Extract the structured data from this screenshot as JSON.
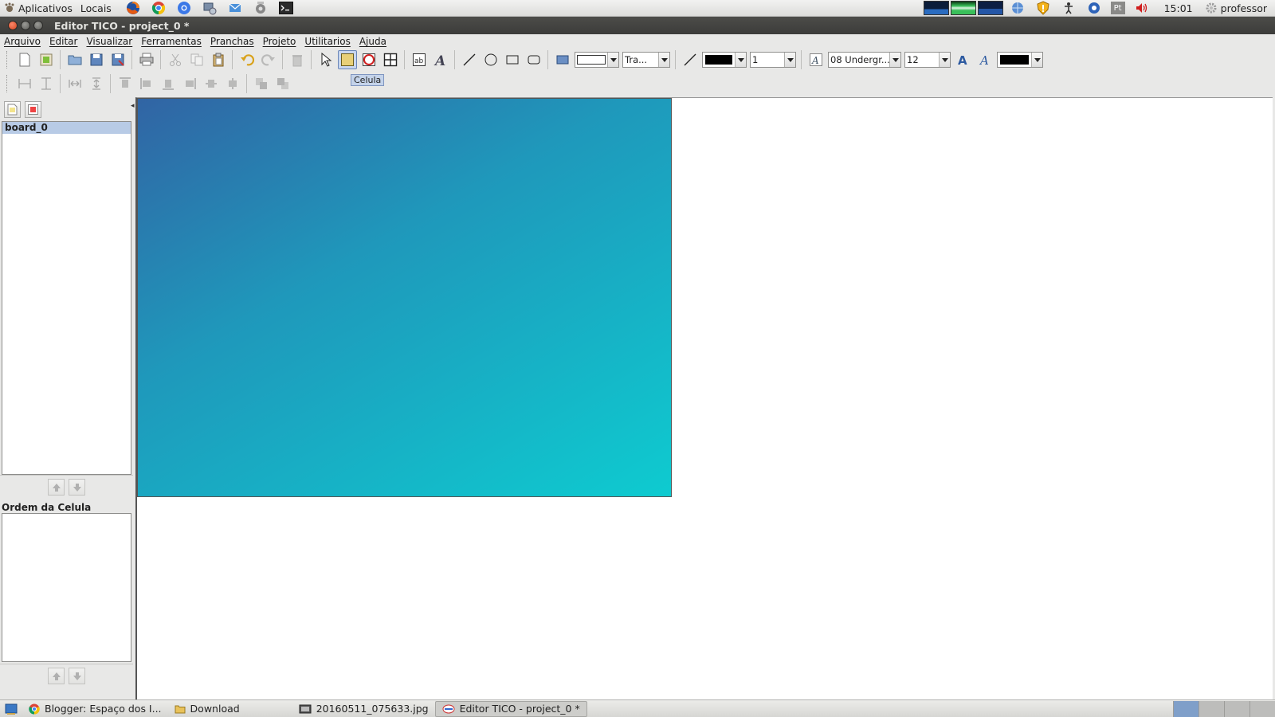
{
  "system_panel": {
    "menus": [
      "Aplicativos",
      "Locais"
    ],
    "launchers": [
      "firefox-icon",
      "chrome-icon",
      "chromium-icon",
      "network-settings-icon",
      "mail-icon",
      "update-icon",
      "terminal-icon"
    ],
    "tray_keyboard_label": "Pt",
    "clock": "15:01",
    "user": "professor"
  },
  "window": {
    "title": "Editor TICO - project_0 *"
  },
  "menubar": {
    "items": [
      "Arquivo",
      "Editar",
      "Visualizar",
      "Ferramentas",
      "Pranchas",
      "Projeto",
      "Utilitarios",
      "Ajuda"
    ]
  },
  "toolbar": {
    "tooltip": "Celula",
    "fill_mode": "Tra...",
    "line_width": "1",
    "font_name": "08 Undergr...",
    "font_size": "12",
    "line_color": "#000000",
    "text_color": "#000000"
  },
  "left_panel": {
    "boards": [
      "board_0"
    ],
    "cell_order_label": "Ordem da Celula"
  },
  "board": {
    "gradient_start": "#3164a4",
    "gradient_end": "#0ecbd0"
  },
  "taskbar": {
    "tasks": [
      {
        "label": "Blogger: Espaço dos I...",
        "icon": "chrome-icon"
      },
      {
        "label": "Download",
        "icon": "folder-icon"
      },
      {
        "label": "20160511_075633.jpg",
        "icon": "image-icon"
      },
      {
        "label": "Editor TICO - project_0 *",
        "icon": "tico-icon"
      }
    ]
  }
}
